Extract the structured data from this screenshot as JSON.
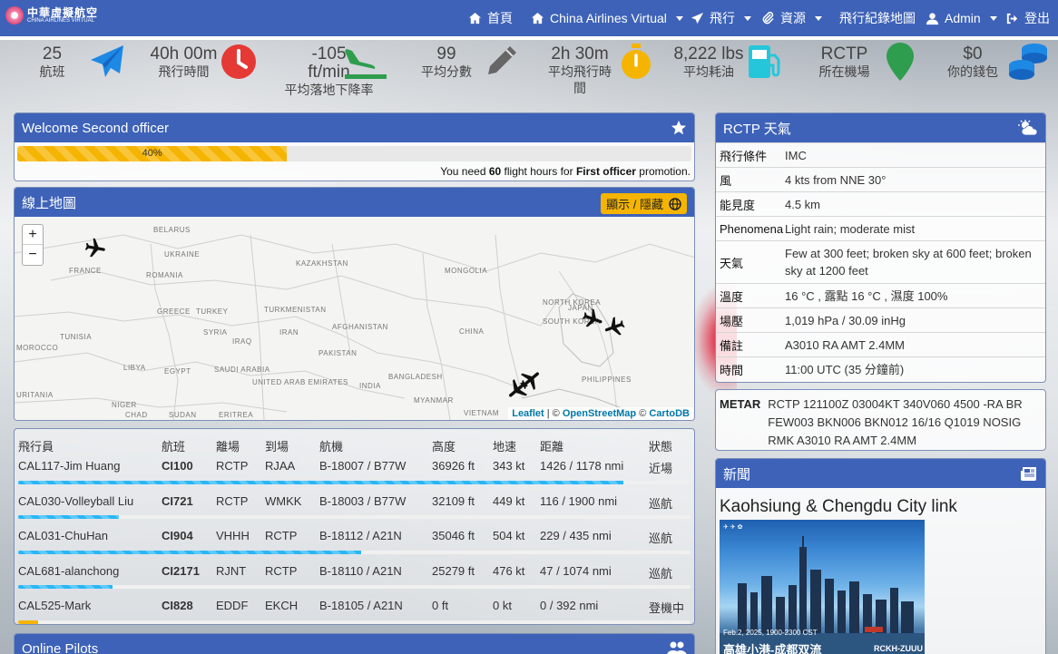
{
  "nav": {
    "logo_cn": "中華虛擬航空",
    "logo_en": "CHINA AIRLINES VIRTUAL",
    "home": "首頁",
    "brand_menu": "China Airlines Virtual",
    "flight_menu": "飛行",
    "resources_menu": "資源",
    "map_link": "飛行紀錄地圖",
    "user_menu": "Admin",
    "logout": "登出"
  },
  "stats": [
    {
      "value": "25",
      "label": "航班",
      "icon": "paper-plane-icon",
      "color": "#1e88e5"
    },
    {
      "value": "40h 00m",
      "label": "飛行時間",
      "icon": "clock-icon",
      "color": "#e53935"
    },
    {
      "value": "-105 ft/min",
      "label": "平均落地下降率",
      "icon": "plane-arrival-icon",
      "color": "#2e9d4e"
    },
    {
      "value": "99",
      "label": "平均分數",
      "icon": "pencil-icon",
      "color": "#666666"
    },
    {
      "value": "2h 30m",
      "label": "平均飛行時間",
      "icon": "stopwatch-icon",
      "color": "#f5b400"
    },
    {
      "value": "8,222 lbs",
      "label": "平均耗油",
      "icon": "gas-pump-icon",
      "color": "#26c6da"
    },
    {
      "value": "RCTP",
      "label": "所在機場",
      "icon": "map-marker-icon",
      "color": "#2e9d4e"
    },
    {
      "value": "$0",
      "label": "你的錢包",
      "icon": "coins-icon",
      "color": "#1e88e5"
    }
  ],
  "welcome": {
    "title": "Welcome Second officer",
    "progress": 40,
    "progress_label": "40%",
    "promo_pre": "You need",
    "promo_hours": "60",
    "promo_mid": "flight hours for",
    "promo_rank": "First officer",
    "promo_post": "promotion."
  },
  "map": {
    "title": "線上地圖",
    "toggle": "顯示 / 隱藏",
    "zoom_in": "+",
    "zoom_out": "−",
    "attrib_leaflet": "Leaflet",
    "attrib_sep1": "| ©",
    "attrib_osm": "OpenStreetMap",
    "attrib_sep2": "©",
    "attrib_carto": "CartoDB",
    "labels": [
      "BELARUS",
      "FRANCE",
      "UKRAINE",
      "ROMANIA",
      "KAZAKHSTAN",
      "MONGOLIA",
      "TURKEY",
      "GREECE",
      "TURKMENISTAN",
      "SYRIA",
      "IRAQ",
      "IRAN",
      "AFGHANISTAN",
      "PAKISTAN",
      "CHINA",
      "NORTH KOREA",
      "SOUTH KOREA",
      "JAPAN",
      "TUNISIA",
      "LIBYA",
      "EGYPT",
      "SAUDI ARABIA",
      "UNITED ARAB EMIRATES",
      "INDIA",
      "BANGLADESH",
      "MYANMAR",
      "MOROCCO",
      "URITANIA",
      "NIGER",
      "CHAD",
      "SUDAN",
      "ERITREA",
      "VIETNAM",
      "PHILIPPINES"
    ]
  },
  "flights": {
    "headers": [
      "飛行員",
      "航班",
      "離場",
      "到場",
      "航機",
      "高度",
      "地速",
      "距離",
      "狀態"
    ],
    "rows": [
      {
        "pilot": "CAL117-Jim Huang",
        "flight": "CI100",
        "dep": "RCTP",
        "arr": "RJAA",
        "aircraft": "B-18007 / B77W",
        "alt": "36926 ft",
        "gs": "343 kt",
        "dist": "1426 / 1178 nmi",
        "status": "近場",
        "progress": 0.9
      },
      {
        "pilot": "CAL030-Volleyball Liu",
        "flight": "CI721",
        "dep": "RCTP",
        "arr": "WMKK",
        "aircraft": "B-18003 / B77W",
        "alt": "32109 ft",
        "gs": "449 kt",
        "dist": "116 / 1900 nmi",
        "status": "巡航",
        "progress": 0.15
      },
      {
        "pilot": "CAL031-ChuHan",
        "flight": "CI904",
        "dep": "VHHH",
        "arr": "RCTP",
        "aircraft": "B-18112 / A21N",
        "alt": "35046 ft",
        "gs": "504 kt",
        "dist": "229 / 435 nmi",
        "status": "巡航",
        "progress": 0.51
      },
      {
        "pilot": "CAL681-alanchong",
        "flight": "CI2171",
        "dep": "RJNT",
        "arr": "RCTP",
        "aircraft": "B-18110 / A21N",
        "alt": "25279 ft",
        "gs": "476 kt",
        "dist": "47 / 1074 nmi",
        "status": "巡航",
        "progress": 0.14
      },
      {
        "pilot": "CAL525-Mark",
        "flight": "CI828",
        "dep": "EDDF",
        "arr": "EKCH",
        "aircraft": "B-18105 / A21N",
        "alt": "0 ft",
        "gs": "0 kt",
        "dist": "0 / 392 nmi",
        "status": "登機中",
        "progress": 0.03
      }
    ]
  },
  "online_pilots": {
    "title": "Online Pilots"
  },
  "weather": {
    "title": "RCTP 天氣",
    "rows": [
      {
        "k": "飛行條件",
        "v": "IMC"
      },
      {
        "k": "風",
        "v": "4 kts from NNE 30°"
      },
      {
        "k": "能見度",
        "v": "4.5 km"
      },
      {
        "k": "Phenomena",
        "v": "Light rain; moderate mist"
      },
      {
        "k": "天氣",
        "v": "Few at 300 feet; broken sky at 600 feet; broken sky at 1200 feet"
      },
      {
        "k": "溫度",
        "v": "16 °C , 露點 16 °C , 濕度 100%"
      },
      {
        "k": "場壓",
        "v": "1,019 hPa / 30.09 inHg"
      },
      {
        "k": "備註",
        "v": "A3010 RA AMT 2.4MM"
      },
      {
        "k": "時間",
        "v": "11:00 UTC (35 分鐘前)"
      }
    ],
    "metar_label": "METAR",
    "metar": "RCTP 121100Z 03004KT 340V060 4500 -RA BR FEW003 BKN006 BKN012 16/16 Q1019 NOSIG RMK A3010 RA AMT 2.4MM"
  },
  "news": {
    "title": "新聞",
    "headline": "Kaohsiung & Chengdu City link",
    "img_date": "Feb.2, 2025, 1900-2300 CST",
    "img_caption": "高雄小港-成都双流",
    "img_route": "RCKH-ZUUU"
  }
}
